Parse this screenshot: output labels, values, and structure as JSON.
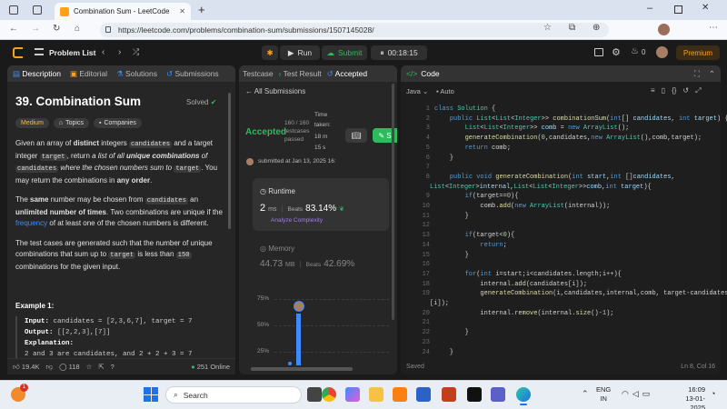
{
  "browser": {
    "tab_title": "Combination Sum - LeetCode",
    "url": "https://leetcode.com/problems/combination-sum/submissions/1507145028/"
  },
  "topbar": {
    "problem_list": "Problem List",
    "run": "Run",
    "submit": "Submit",
    "timer": "00:18:15",
    "notif_count": "0",
    "premium": "Premium"
  },
  "left": {
    "tabs": [
      "Description",
      "Editorial",
      "Solutions",
      "Submissions"
    ],
    "title": "39. Combination Sum",
    "solved": "Solved",
    "tags": [
      "Medium",
      "Topics",
      "Companies"
    ],
    "p1_a": "Given an array of ",
    "p1_b": "distinct",
    "p1_c": " integers ",
    "p1_code1": "candidates",
    "p1_d": " and a target integer ",
    "p1_code2": "target",
    "p1_e": ", return ",
    "p1_f": "a list of all ",
    "p1_g": "unique combinations",
    "p1_h": " of ",
    "p1_code3": "candidates",
    "p1_i": " where the chosen numbers sum to ",
    "p1_code4": "target",
    "p1_j": ". You may return the combinations in ",
    "p1_k": "any order",
    "p1_l": ".",
    "p2_a": "The ",
    "p2_b": "same",
    "p2_c": " number may be chosen from ",
    "p2_code": "candidates",
    "p2_d": " an ",
    "p2_e": "unlimited number of times",
    "p2_f": ". Two combinations are unique if the ",
    "p2_g": "frequency",
    "p2_h": " of at least one of the chosen numbers is different.",
    "p3_a": "The test cases are generated such that the number of unique combinations that sum up to ",
    "p3_code1": "target",
    "p3_b": " is less than ",
    "p3_code2": "150",
    "p3_c": " combinations for the given input.",
    "ex_title": "Example 1:",
    "ex_input_label": "Input:",
    "ex_input": " candidates = [2,3,6,7], target = 7",
    "ex_output_label": "Output:",
    "ex_output": " [[2,2,3],[7]]",
    "ex_expl_label": "Explanation:",
    "ex_expl": "2 and 3 are candidates, and 2 + 2 + 3 = 7",
    "likes": "19.4K",
    "comments": "118",
    "online": "251 Online"
  },
  "mid": {
    "tabs": [
      "Testcase",
      "Test Result",
      "Accepted"
    ],
    "back": "All Submissions",
    "status": "Accepted",
    "passed": "160 / 160 testcases passed",
    "time_label": "Time taken:",
    "time_value": "18 m 15 s",
    "submitted": "submitted at Jan 13, 2025 16:",
    "runtime_label": "Runtime",
    "runtime_value": "2",
    "runtime_unit": "ms",
    "beats_label": "Beats",
    "runtime_beats": "83.14%",
    "analyze": "Analyze Complexity",
    "memory_label": "Memory",
    "memory_value": "44.73",
    "memory_unit": "MB",
    "memory_beats": "42.69%",
    "y_ticks": [
      "75%",
      "50%",
      "25%"
    ]
  },
  "code": {
    "title": "Code",
    "lang": "Java",
    "auto": "Auto",
    "status": "Saved",
    "cursor": "Ln 8, Col 16"
  },
  "taskbar": {
    "search": "Search",
    "lang1": "ENG",
    "lang2": "IN",
    "time": "16:09",
    "date": "13-01-2025",
    "badge": "1"
  },
  "colors": {
    "accent_green": "#2cbb5d",
    "medium": "#ffc01e",
    "premium": "#ffa116"
  }
}
